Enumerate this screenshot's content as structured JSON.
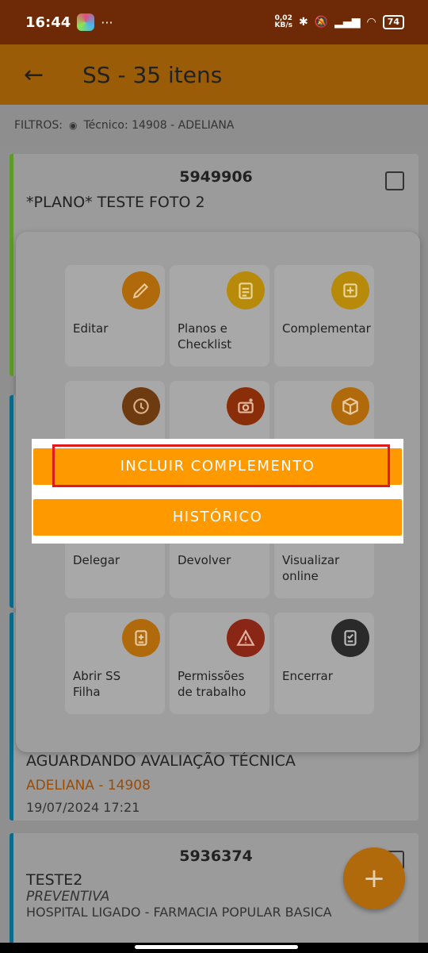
{
  "status_bar": {
    "time": "16:44",
    "more": "···",
    "net_speed": "0,02\nKB/s",
    "battery": "74"
  },
  "app_bar": {
    "title": "SS - 35 itens",
    "back_icon": "arrow-left-icon"
  },
  "filters": {
    "label": "FILTROS:",
    "value": "Técnico: 14908 - ADELIANA"
  },
  "cards": [
    {
      "number": "5949906",
      "title": "*PLANO* TESTE FOTO 2"
    },
    {
      "status": "AGUARDANDO AVALIAÇÃO TÉCNICA",
      "user": "ADELIANA - 14908",
      "date": "19/07/2024 17:21"
    },
    {
      "number": "5936374",
      "title": "TESTE2",
      "type": "PREVENTIVA",
      "location": "HOSPITAL LIGADO - FARMACIA POPULAR BASICA"
    }
  ],
  "actions": [
    {
      "label": "Editar",
      "icon": "pencil-icon",
      "color": "#b06a0c"
    },
    {
      "label": "Planos e\nChecklist",
      "icon": "clipboard-list-icon",
      "color": "#b88a0a"
    },
    {
      "label": "Complementar",
      "icon": "add-document-icon",
      "color": "#b88a0a"
    },
    {
      "label": "",
      "icon": "clock-icon",
      "color": "#6e3a0f"
    },
    {
      "label": "",
      "icon": "camera-plus-icon",
      "color": "#8a2e0a"
    },
    {
      "label": "",
      "icon": "box-icon",
      "color": "#b06a0c"
    },
    {
      "label": "Delegar",
      "icon": "",
      "color": ""
    },
    {
      "label": "Devolver",
      "icon": "",
      "color": ""
    },
    {
      "label": "Visualizar\nonline",
      "icon": "",
      "color": ""
    },
    {
      "label": "Abrir SS\nFilha",
      "icon": "document-plus-icon",
      "color": "#b06a0c"
    },
    {
      "label": "Permissões\nde trabalho",
      "icon": "warning-icon",
      "color": "#8a2616"
    },
    {
      "label": "Encerrar",
      "icon": "checklist-icon",
      "color": "#2a2a2a"
    }
  ],
  "dialog": {
    "primary": "INCLUIR COMPLEMENTO",
    "secondary": "HISTÓRICO"
  },
  "fab": {
    "label": "+"
  }
}
